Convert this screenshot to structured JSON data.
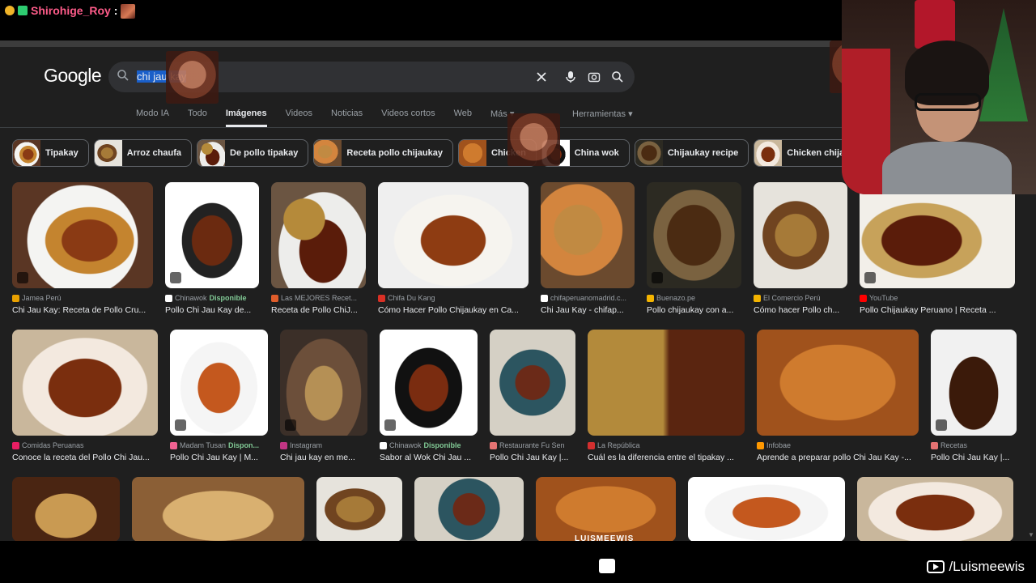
{
  "chat": {
    "username": "Shirohige_Roy",
    "separator": ":"
  },
  "google": {
    "logo_text": "Google",
    "search_query_selected": "chi jau kay",
    "tabs": [
      {
        "label": "Modo IA"
      },
      {
        "label": "Todo"
      },
      {
        "label": "Imágenes",
        "active": true
      },
      {
        "label": "Videos"
      },
      {
        "label": "Noticias"
      },
      {
        "label": "Videos cortos"
      },
      {
        "label": "Web"
      },
      {
        "label": "Más ▾"
      }
    ],
    "tools_label": "Herramientas ▾",
    "chips": [
      {
        "label": "Tipakay"
      },
      {
        "label": "Arroz chaufa"
      },
      {
        "label": "De pollo tipakay"
      },
      {
        "label": "Receta pollo chijaukay"
      },
      {
        "label": "Chicken"
      },
      {
        "label": "China wok"
      },
      {
        "label": "Chijaukay recipe"
      },
      {
        "label": "Chicken chijaukay"
      }
    ],
    "row1": [
      {
        "source": "Jamea Perú",
        "title": "Chi Jau Kay: Receta de Pollo Cru...",
        "fav": "#e8a000"
      },
      {
        "source": "Chinawok",
        "available": "Disponible",
        "title": "Pollo Chi Jau Kay de...",
        "fav": "#ffffff"
      },
      {
        "source": "Las MEJORES Recet...",
        "title": "Receta de Pollo ChiJ...",
        "fav": "#e05d2b"
      },
      {
        "source": "Chifa Du Kang",
        "title": "Cómo Hacer Pollo Chijaukay en Ca...",
        "fav": "#d93025"
      },
      {
        "source": "chifaperuanomadrid.c...",
        "title": "Chi Jau Kay - chifap...",
        "fav": "#ffffff"
      },
      {
        "source": "Buenazo.pe",
        "title": "Pollo chijaukay con a...",
        "fav": "#f4b400"
      },
      {
        "source": "El Comercio Perú",
        "title": "Cómo hacer Pollo ch...",
        "fav": "#f4b400"
      },
      {
        "source": "YouTube",
        "title": "Pollo Chijaukay Peruano | Receta ...",
        "fav": "#ff0000"
      }
    ],
    "row2": [
      {
        "source": "Comidas Peruanas",
        "title": "Conoce la receta del Pollo Chi Jau...",
        "fav": "#e91e63"
      },
      {
        "source": "Madam Tusan",
        "available": "Dispon...",
        "title": "Pollo Chi Jau Kay | M...",
        "fav": "#f06292"
      },
      {
        "source": "Instagram",
        "title": "Chi jau kay en me...",
        "fav": "#c13584"
      },
      {
        "source": "Chinawok",
        "available": "Disponible",
        "title": "Sabor al Wok Chi Jau ...",
        "fav": "#ffffff"
      },
      {
        "source": "Restaurante Fu Sen",
        "title": "Pollo Chi Jau Kay |...",
        "fav": "#e57373"
      },
      {
        "source": "La República",
        "title": "Cuál es la diferencia entre el tipakay ...",
        "fav": "#d32f2f"
      },
      {
        "source": "Infobae",
        "title": "Aprende a preparar pollo Chi Jau Kay -...",
        "fav": "#ff9800"
      },
      {
        "source": "Recetas",
        "title": "Pollo Chi Jau Kay |...",
        "fav": "#e57373"
      }
    ]
  },
  "overlay": {
    "watermark": "LUISMEEWIS",
    "handle": "/Luismeewis"
  }
}
